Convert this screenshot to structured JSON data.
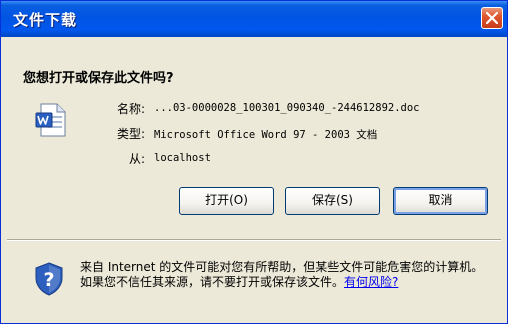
{
  "window": {
    "title": "文件下载"
  },
  "prompt": "您想打开或保存此文件吗?",
  "file": {
    "name_label": "名称:",
    "name_value": "...03-0000028_100301_090340_-244612892.doc",
    "type_label": "类型:",
    "type_value": "Microsoft Office Word 97 - 2003 文档",
    "from_label": "从:",
    "from_value": "localhost",
    "icon": "word-document-icon"
  },
  "buttons": {
    "open": "打开(O)",
    "save": "保存(S)",
    "cancel": "取消"
  },
  "warning": {
    "text": "来自 Internet 的文件可能对您有所帮助，但某些文件可能危害您的计算机。如果您不信任其来源，请不要打开或保存该文件。",
    "link": "有何风险?",
    "icon": "shield-question-icon"
  },
  "colors": {
    "titlebar": "#0054e3",
    "close": "#e0582e",
    "link": "#0000ee"
  }
}
